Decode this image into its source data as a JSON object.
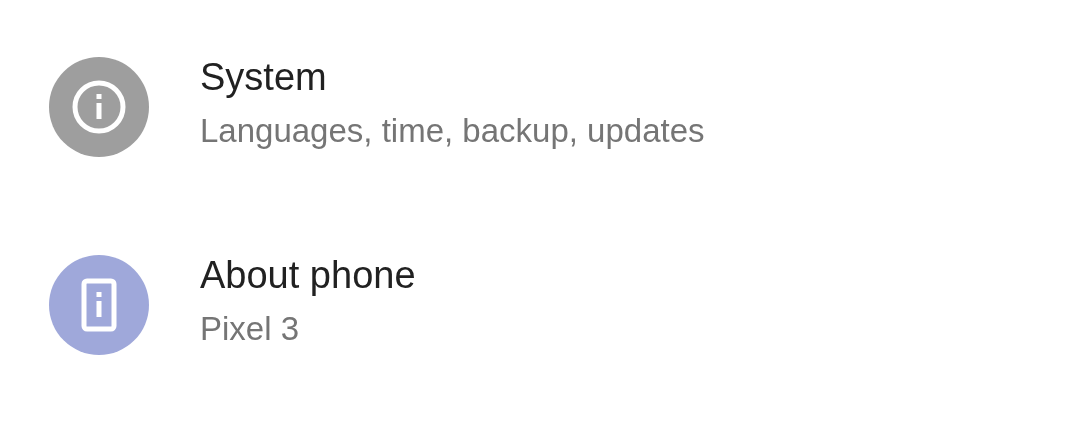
{
  "settings_items": [
    {
      "kind": "info",
      "color": "#9e9e9e",
      "title": "System",
      "summary": "Languages, time, backup, updates"
    },
    {
      "kind": "phone-info",
      "color": "#9fa8da",
      "title": "About phone",
      "summary": "Pixel 3"
    }
  ]
}
